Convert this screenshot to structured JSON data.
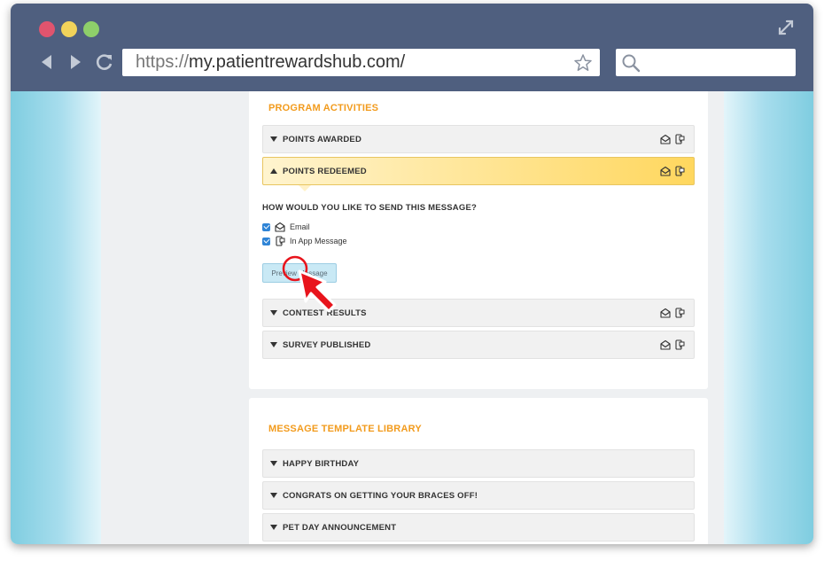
{
  "browser": {
    "url_scheme": "https://",
    "url_host": "my.patientrewardshub.com/",
    "search_placeholder": ""
  },
  "program_activities": {
    "title": "PROGRAM ACTIVITIES",
    "rows": [
      {
        "label": "POINTS AWARDED",
        "expanded": false
      },
      {
        "label": "POINTS REDEEMED",
        "expanded": true
      },
      {
        "label": "CONTEST RESULTS",
        "expanded": false
      },
      {
        "label": "SURVEY PUBLISHED",
        "expanded": false
      }
    ],
    "question": "HOW WOULD YOU LIKE TO SEND THIS MESSAGE?",
    "options": [
      {
        "label": "Email",
        "checked": true,
        "icon": "envelope-icon"
      },
      {
        "label": "In App Message",
        "checked": true,
        "icon": "phone-message-icon"
      }
    ],
    "preview_button": "Preview Message"
  },
  "template_library": {
    "title": "MESSAGE TEMPLATE LIBRARY",
    "rows": [
      {
        "label": "HAPPY BIRTHDAY"
      },
      {
        "label": "CONGRATS ON GETTING YOUR BRACES OFF!"
      },
      {
        "label": "PET DAY ANNOUNCEMENT"
      }
    ]
  },
  "colors": {
    "titlebar": "#4f5f7f",
    "section_title": "#f29b1d",
    "checkbox": "#2f84d6",
    "cursor_red": "#e8141c"
  }
}
